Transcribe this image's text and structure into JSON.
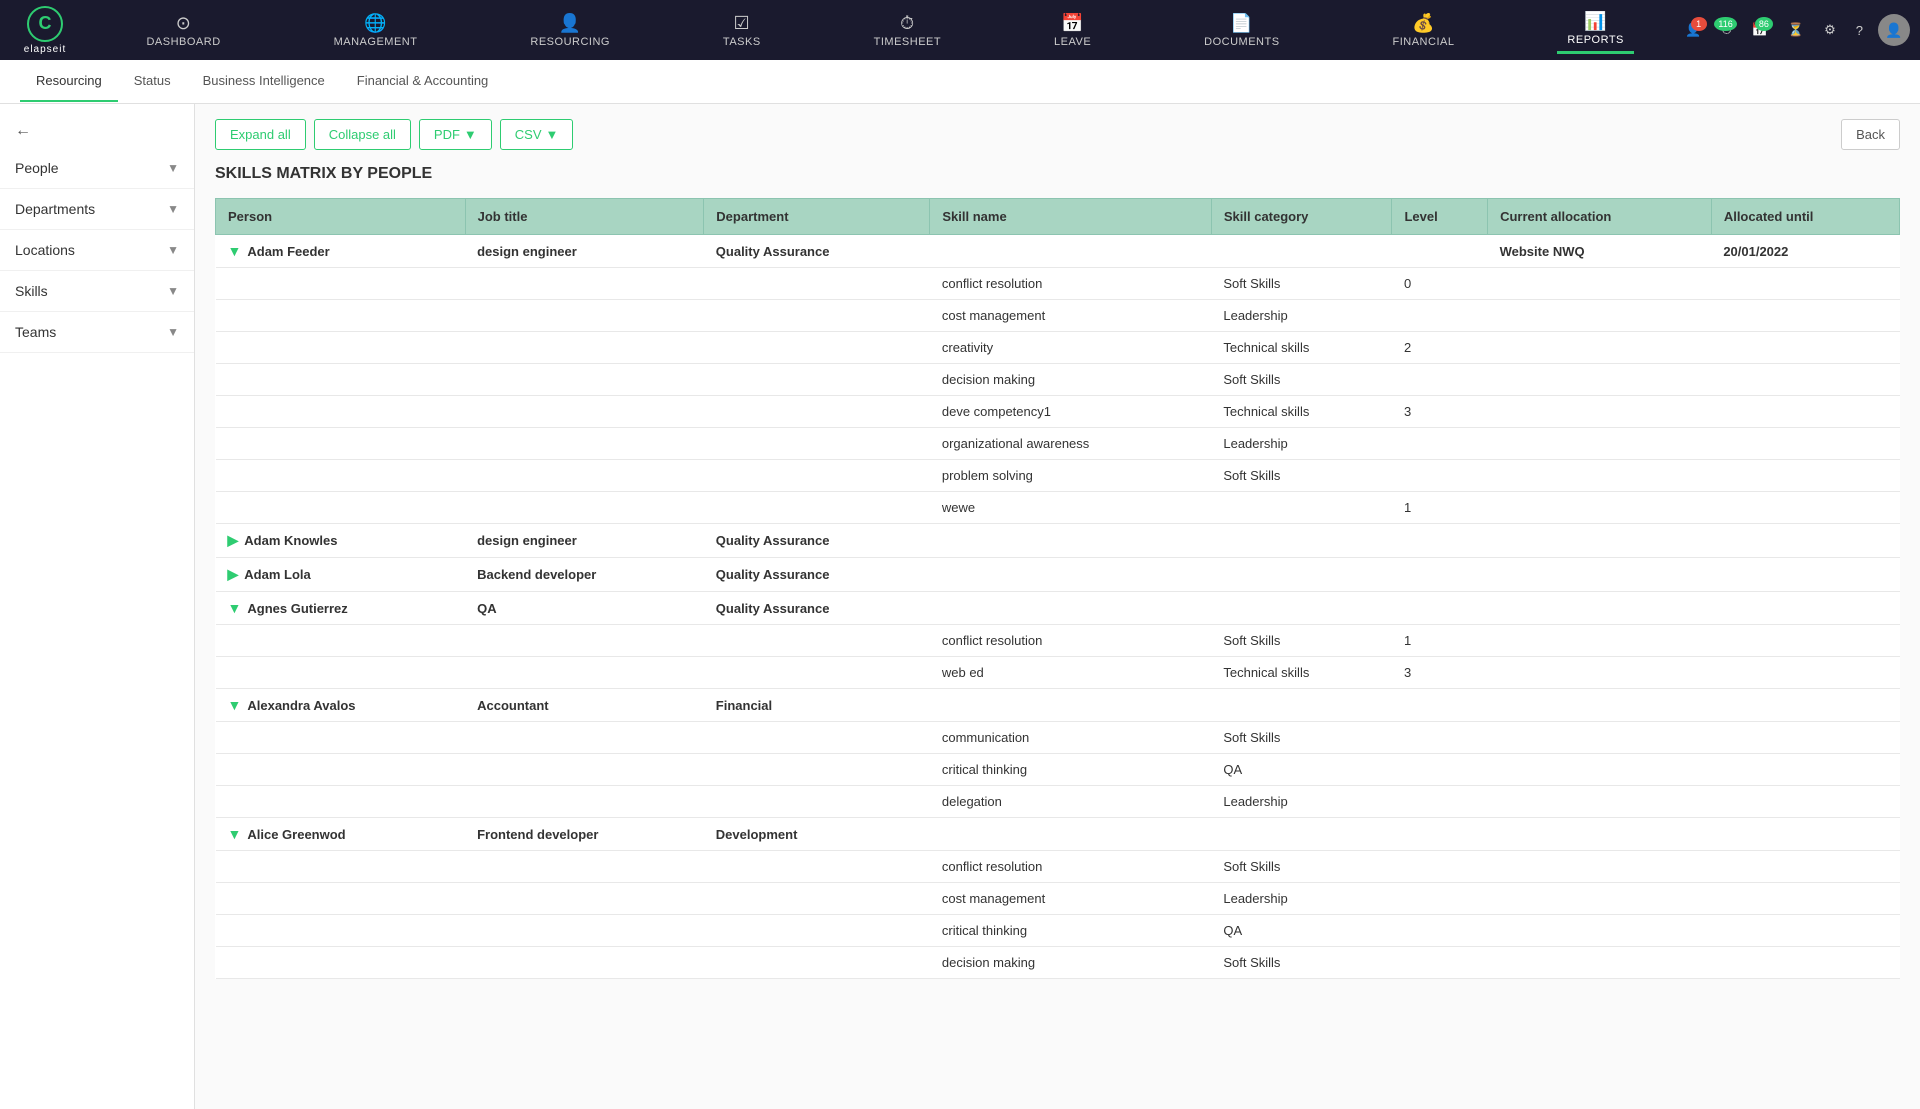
{
  "app": {
    "logo": "C",
    "logo_name": "elapseit"
  },
  "nav": {
    "items": [
      {
        "id": "dashboard",
        "label": "DASHBOARD",
        "icon": "⊙"
      },
      {
        "id": "management",
        "label": "MANAGEMENT",
        "icon": "🌐"
      },
      {
        "id": "resourcing",
        "label": "RESOURCING",
        "icon": "👤"
      },
      {
        "id": "tasks",
        "label": "TASKS",
        "icon": "☑"
      },
      {
        "id": "timesheet",
        "label": "TIMESHEET",
        "icon": "⏱"
      },
      {
        "id": "leave",
        "label": "LEAVE",
        "icon": "📅"
      },
      {
        "id": "documents",
        "label": "DOCUMENTS",
        "icon": "📄"
      },
      {
        "id": "financial",
        "label": "FINANCIAL",
        "icon": "💰"
      },
      {
        "id": "reports",
        "label": "REPORTS",
        "icon": "📊"
      }
    ],
    "active": "reports",
    "badges": [
      {
        "icon": "👤",
        "count": "1",
        "type": "red"
      },
      {
        "icon": "⏱",
        "count": "116",
        "type": "green"
      },
      {
        "icon": "📅",
        "count": "86",
        "type": "green"
      },
      {
        "icon": "⏳",
        "count": "",
        "type": "none"
      }
    ]
  },
  "sub_nav": {
    "items": [
      {
        "id": "resourcing",
        "label": "Resourcing",
        "active": true
      },
      {
        "id": "status",
        "label": "Status"
      },
      {
        "id": "bi",
        "label": "Business Intelligence"
      },
      {
        "id": "financial",
        "label": "Financial & Accounting"
      }
    ]
  },
  "sidebar": {
    "items": [
      {
        "id": "people",
        "label": "People"
      },
      {
        "id": "departments",
        "label": "Departments"
      },
      {
        "id": "locations",
        "label": "Locations"
      },
      {
        "id": "skills",
        "label": "Skills"
      },
      {
        "id": "teams",
        "label": "Teams"
      }
    ]
  },
  "toolbar": {
    "expand_all": "Expand all",
    "collapse_all": "Collapse all",
    "pdf": "PDF",
    "csv": "CSV",
    "back": "Back"
  },
  "table": {
    "title": "SKILLS MATRIX BY PEOPLE",
    "headers": [
      "Person",
      "Job title",
      "Department",
      "Skill name",
      "Skill category",
      "Level",
      "Current allocation",
      "Allocated until"
    ],
    "rows": [
      {
        "type": "person",
        "name": "Adam Feeder",
        "job": "design engineer",
        "dept": "Quality Assurance",
        "skill": "",
        "category": "",
        "level": "",
        "allocation": "Website NWQ",
        "until": "20/01/2022",
        "icon": "▼"
      },
      {
        "type": "skill",
        "name": "",
        "job": "",
        "dept": "",
        "skill": "conflict resolution",
        "category": "Soft Skills",
        "level": "0",
        "allocation": "",
        "until": ""
      },
      {
        "type": "skill",
        "name": "",
        "job": "",
        "dept": "",
        "skill": "cost management",
        "category": "Leadership",
        "level": "",
        "allocation": "",
        "until": ""
      },
      {
        "type": "skill",
        "name": "",
        "job": "",
        "dept": "",
        "skill": "creativity",
        "category": "Technical skills",
        "level": "2",
        "allocation": "",
        "until": ""
      },
      {
        "type": "skill",
        "name": "",
        "job": "",
        "dept": "",
        "skill": "decision making",
        "category": "Soft Skills",
        "level": "",
        "allocation": "",
        "until": ""
      },
      {
        "type": "skill",
        "name": "",
        "job": "",
        "dept": "",
        "skill": "deve competency1",
        "category": "Technical skills",
        "level": "3",
        "allocation": "",
        "until": ""
      },
      {
        "type": "skill",
        "name": "",
        "job": "",
        "dept": "",
        "skill": "organizational awareness",
        "category": "Leadership",
        "level": "",
        "allocation": "",
        "until": ""
      },
      {
        "type": "skill",
        "name": "",
        "job": "",
        "dept": "",
        "skill": "problem solving",
        "category": "Soft Skills",
        "level": "",
        "allocation": "",
        "until": ""
      },
      {
        "type": "skill",
        "name": "",
        "job": "",
        "dept": "",
        "skill": "wewe",
        "category": "",
        "level": "1",
        "allocation": "",
        "until": ""
      },
      {
        "type": "person",
        "name": "Adam Knowles",
        "job": "design engineer",
        "dept": "Quality Assurance",
        "skill": "",
        "category": "",
        "level": "",
        "allocation": "",
        "until": "",
        "icon": "▶"
      },
      {
        "type": "person",
        "name": "Adam Lola",
        "job": "Backend developer",
        "dept": "Quality Assurance",
        "skill": "",
        "category": "",
        "level": "",
        "allocation": "",
        "until": "",
        "icon": "▶"
      },
      {
        "type": "person",
        "name": "Agnes Gutierrez",
        "job": "QA",
        "dept": "Quality Assurance",
        "skill": "",
        "category": "",
        "level": "",
        "allocation": "",
        "until": "",
        "icon": "▼"
      },
      {
        "type": "skill",
        "name": "",
        "job": "",
        "dept": "",
        "skill": "conflict resolution",
        "category": "Soft Skills",
        "level": "1",
        "allocation": "",
        "until": ""
      },
      {
        "type": "skill",
        "name": "",
        "job": "",
        "dept": "",
        "skill": "web ed",
        "category": "Technical skills",
        "level": "3",
        "allocation": "",
        "until": ""
      },
      {
        "type": "person",
        "name": "Alexandra Avalos",
        "job": "Accountant",
        "dept": "Financial",
        "skill": "",
        "category": "",
        "level": "",
        "allocation": "",
        "until": "",
        "icon": "▼"
      },
      {
        "type": "skill",
        "name": "",
        "job": "",
        "dept": "",
        "skill": "communication",
        "category": "Soft Skills",
        "level": "",
        "allocation": "",
        "until": ""
      },
      {
        "type": "skill",
        "name": "",
        "job": "",
        "dept": "",
        "skill": "critical thinking",
        "category": "QA",
        "level": "",
        "allocation": "",
        "until": ""
      },
      {
        "type": "skill",
        "name": "",
        "job": "",
        "dept": "",
        "skill": "delegation",
        "category": "Leadership",
        "level": "",
        "allocation": "",
        "until": ""
      },
      {
        "type": "person",
        "name": "Alice Greenwod",
        "job": "Frontend developer",
        "dept": "Development",
        "skill": "",
        "category": "",
        "level": "",
        "allocation": "",
        "until": "",
        "icon": "▼"
      },
      {
        "type": "skill",
        "name": "",
        "job": "",
        "dept": "",
        "skill": "conflict resolution",
        "category": "Soft Skills",
        "level": "",
        "allocation": "",
        "until": ""
      },
      {
        "type": "skill",
        "name": "",
        "job": "",
        "dept": "",
        "skill": "cost management",
        "category": "Leadership",
        "level": "",
        "allocation": "",
        "until": ""
      },
      {
        "type": "skill",
        "name": "",
        "job": "",
        "dept": "",
        "skill": "critical thinking",
        "category": "QA",
        "level": "",
        "allocation": "",
        "until": ""
      },
      {
        "type": "skill",
        "name": "",
        "job": "",
        "dept": "",
        "skill": "decision making",
        "category": "Soft Skills",
        "level": "",
        "allocation": "",
        "until": ""
      }
    ]
  }
}
